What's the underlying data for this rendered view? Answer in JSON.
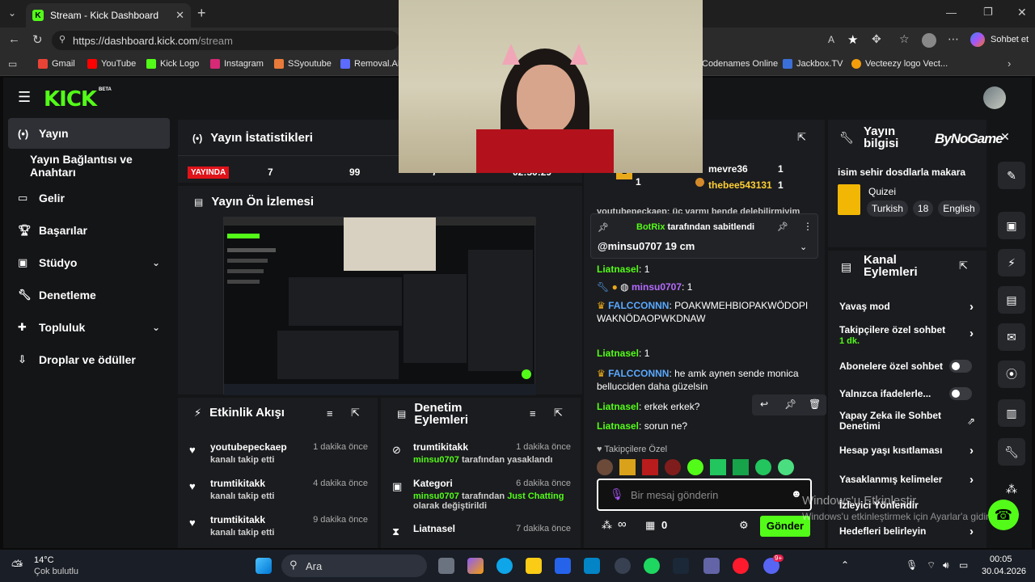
{
  "browser": {
    "tab_title": "Stream - Kick Dashboard",
    "url_host": "https://dashboard.kick.com",
    "url_path": "/stream",
    "copilot_label": "Sohbet et",
    "bookmarks": [
      "Gmail",
      "YouTube",
      "Kick Logo",
      "Instagram",
      "SSyoutube",
      "Removal.AI",
      "Codenames Online",
      "Jackbox.TV",
      "Vecteezy logo Vect..."
    ]
  },
  "brand": {
    "logo": "KICK",
    "beta": "BETA"
  },
  "sidebar": {
    "items": [
      {
        "label": "Yayın",
        "icon": "broadcast-icon"
      },
      {
        "label": "Yayın Bağlantısı ve Anahtarı",
        "icon": ""
      },
      {
        "label": "Gelir",
        "icon": "money-icon"
      },
      {
        "label": "Başarılar",
        "icon": "trophy-icon"
      },
      {
        "label": "Stüdyo",
        "icon": "studio-icon"
      },
      {
        "label": "Denetleme",
        "icon": "wrench-icon"
      },
      {
        "label": "Topluluk",
        "icon": "community-icon"
      },
      {
        "label": "Droplar ve ödüller",
        "icon": "drops-icon"
      }
    ]
  },
  "stats": {
    "title": "Yayın İstatistikleri",
    "live_badge": "YAYINDA",
    "viewers": "7",
    "followers": "99",
    "subs": "7",
    "uptime": "02:50:29"
  },
  "preview": {
    "title": "Yayın Ön İzlemesi"
  },
  "activity": {
    "title": "Etkinlik Akışı",
    "events": [
      {
        "name": "youtubepeckaep",
        "sub": "kanalı takip etti",
        "time": "1 dakika önce"
      },
      {
        "name": "trumtikitakk",
        "sub": "kanalı takip etti",
        "time": "4 dakika önce"
      },
      {
        "name": "trumtikitakk",
        "sub": "kanalı takip etti",
        "time": "9 dakika önce"
      }
    ]
  },
  "modactions": {
    "title": "Denetim Eylemleri",
    "items": [
      {
        "name": "trumtikitakk",
        "by": "minsu0707",
        "sub": "tarafından yasaklandı",
        "extra": "",
        "time": "1 dakika önce"
      },
      {
        "name": "Kategori",
        "by": "minsu0707",
        "sub": "tarafından",
        "extra_green": "Just Chatting",
        "extra": "olarak değiştirildi",
        "time": "6 dakika önce"
      },
      {
        "name": "Liatnasel",
        "by": "",
        "sub": "",
        "extra": "",
        "time": "7 dakika önce"
      }
    ]
  },
  "chat": {
    "leaders": [
      {
        "name": "minsu0707",
        "count": "1"
      },
      {
        "name": "mevre36",
        "count": "1"
      },
      {
        "name": "thebee543131",
        "count": "1"
      }
    ],
    "cut_message": "youtubepeckaep: üç varmı bende delebilirmiyim",
    "pinned_by": "BotRix",
    "pinned_suffix": "tarafından sabitlendi",
    "pinned_text": "@minsu0707 19 cm",
    "messages": [
      {
        "user": "Liatnasel",
        "text": "1"
      },
      {
        "user": "minsu0707",
        "text": "1"
      },
      {
        "user": "FALCCONNN",
        "text": "POAKWMEHBIOPAKWÖDOPIWAKNÖDAOPWKDNAW"
      },
      {
        "user": "Liatnasel",
        "text": "1"
      },
      {
        "user": "FALCCONNN",
        "text": "he amk aynen sende monica bellucciden daha güzelsin"
      },
      {
        "user": "Liatnasel",
        "text": "erkek erkek?"
      },
      {
        "user": "Liatnasel",
        "text": "sorun ne?"
      }
    ],
    "followers_only": "Takipçilere Özel",
    "input_placeholder": "Bir mesaj gönderin",
    "points": "∞",
    "gift_count": "0",
    "send_label": "Gönder"
  },
  "streaminfo": {
    "title_line1": "Yayın",
    "title_line2": "bilgisi",
    "stream_title": "isim sehir dosdlarla makara",
    "category": "Quizei",
    "tags": [
      "Turkish",
      "18",
      "English"
    ],
    "overlay_brand": "ByNoGame"
  },
  "channel": {
    "title_line1": "Kanal",
    "title_line2": "Eylemleri",
    "rows": [
      {
        "label": "Yavaş mod",
        "type": "arrow"
      },
      {
        "label": "Takipçilere özel sohbet",
        "sub": "1 dk.",
        "type": "arrow"
      },
      {
        "label": "Abonelere özel sohbet",
        "type": "toggle"
      },
      {
        "label": "Yalnızca ifadelerle...",
        "type": "toggle"
      },
      {
        "label": "Yapay Zeka ile Sohbet Denetimi",
        "type": "ext"
      },
      {
        "label": "Hesap yaşı kısıtlaması",
        "type": "arrow"
      },
      {
        "label": "Yasaklanmış kelimeler",
        "type": "arrow"
      },
      {
        "label": "İzleyici Yönlendir",
        "type": "none"
      },
      {
        "label": "Hedefleri belirleyin",
        "type": "arrow"
      }
    ]
  },
  "watermark": {
    "line1": "Windows'u Etkinleştir",
    "line2": "Windows'u etkinleştirmek için Ayarlar'a gidin."
  },
  "taskbar": {
    "temp": "14°C",
    "weather": "Çok bulutlu",
    "search": "Ara",
    "time": "00:05",
    "date": "30.04.2026",
    "discord_badge": "9+"
  }
}
